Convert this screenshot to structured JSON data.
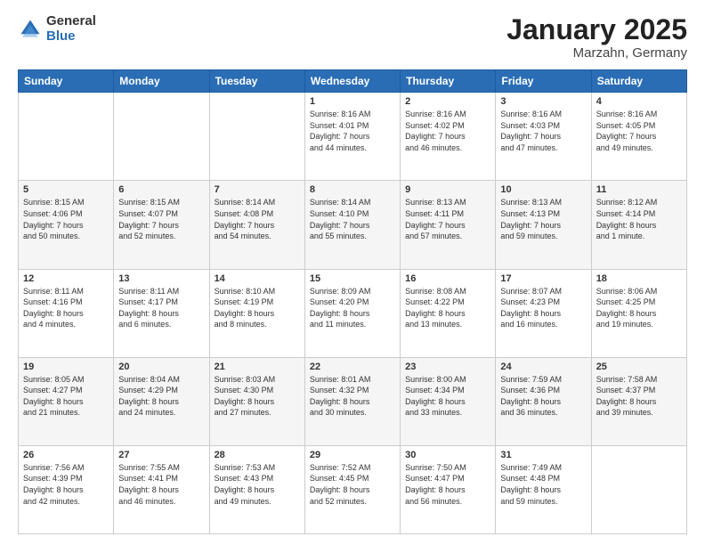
{
  "header": {
    "logo_general": "General",
    "logo_blue": "Blue",
    "title": "January 2025",
    "location": "Marzahn, Germany"
  },
  "days_of_week": [
    "Sunday",
    "Monday",
    "Tuesday",
    "Wednesday",
    "Thursday",
    "Friday",
    "Saturday"
  ],
  "weeks": [
    [
      {
        "day": "",
        "info": ""
      },
      {
        "day": "",
        "info": ""
      },
      {
        "day": "",
        "info": ""
      },
      {
        "day": "1",
        "info": "Sunrise: 8:16 AM\nSunset: 4:01 PM\nDaylight: 7 hours\nand 44 minutes."
      },
      {
        "day": "2",
        "info": "Sunrise: 8:16 AM\nSunset: 4:02 PM\nDaylight: 7 hours\nand 46 minutes."
      },
      {
        "day": "3",
        "info": "Sunrise: 8:16 AM\nSunset: 4:03 PM\nDaylight: 7 hours\nand 47 minutes."
      },
      {
        "day": "4",
        "info": "Sunrise: 8:16 AM\nSunset: 4:05 PM\nDaylight: 7 hours\nand 49 minutes."
      }
    ],
    [
      {
        "day": "5",
        "info": "Sunrise: 8:15 AM\nSunset: 4:06 PM\nDaylight: 7 hours\nand 50 minutes."
      },
      {
        "day": "6",
        "info": "Sunrise: 8:15 AM\nSunset: 4:07 PM\nDaylight: 7 hours\nand 52 minutes."
      },
      {
        "day": "7",
        "info": "Sunrise: 8:14 AM\nSunset: 4:08 PM\nDaylight: 7 hours\nand 54 minutes."
      },
      {
        "day": "8",
        "info": "Sunrise: 8:14 AM\nSunset: 4:10 PM\nDaylight: 7 hours\nand 55 minutes."
      },
      {
        "day": "9",
        "info": "Sunrise: 8:13 AM\nSunset: 4:11 PM\nDaylight: 7 hours\nand 57 minutes."
      },
      {
        "day": "10",
        "info": "Sunrise: 8:13 AM\nSunset: 4:13 PM\nDaylight: 7 hours\nand 59 minutes."
      },
      {
        "day": "11",
        "info": "Sunrise: 8:12 AM\nSunset: 4:14 PM\nDaylight: 8 hours\nand 1 minute."
      }
    ],
    [
      {
        "day": "12",
        "info": "Sunrise: 8:11 AM\nSunset: 4:16 PM\nDaylight: 8 hours\nand 4 minutes."
      },
      {
        "day": "13",
        "info": "Sunrise: 8:11 AM\nSunset: 4:17 PM\nDaylight: 8 hours\nand 6 minutes."
      },
      {
        "day": "14",
        "info": "Sunrise: 8:10 AM\nSunset: 4:19 PM\nDaylight: 8 hours\nand 8 minutes."
      },
      {
        "day": "15",
        "info": "Sunrise: 8:09 AM\nSunset: 4:20 PM\nDaylight: 8 hours\nand 11 minutes."
      },
      {
        "day": "16",
        "info": "Sunrise: 8:08 AM\nSunset: 4:22 PM\nDaylight: 8 hours\nand 13 minutes."
      },
      {
        "day": "17",
        "info": "Sunrise: 8:07 AM\nSunset: 4:23 PM\nDaylight: 8 hours\nand 16 minutes."
      },
      {
        "day": "18",
        "info": "Sunrise: 8:06 AM\nSunset: 4:25 PM\nDaylight: 8 hours\nand 19 minutes."
      }
    ],
    [
      {
        "day": "19",
        "info": "Sunrise: 8:05 AM\nSunset: 4:27 PM\nDaylight: 8 hours\nand 21 minutes."
      },
      {
        "day": "20",
        "info": "Sunrise: 8:04 AM\nSunset: 4:29 PM\nDaylight: 8 hours\nand 24 minutes."
      },
      {
        "day": "21",
        "info": "Sunrise: 8:03 AM\nSunset: 4:30 PM\nDaylight: 8 hours\nand 27 minutes."
      },
      {
        "day": "22",
        "info": "Sunrise: 8:01 AM\nSunset: 4:32 PM\nDaylight: 8 hours\nand 30 minutes."
      },
      {
        "day": "23",
        "info": "Sunrise: 8:00 AM\nSunset: 4:34 PM\nDaylight: 8 hours\nand 33 minutes."
      },
      {
        "day": "24",
        "info": "Sunrise: 7:59 AM\nSunset: 4:36 PM\nDaylight: 8 hours\nand 36 minutes."
      },
      {
        "day": "25",
        "info": "Sunrise: 7:58 AM\nSunset: 4:37 PM\nDaylight: 8 hours\nand 39 minutes."
      }
    ],
    [
      {
        "day": "26",
        "info": "Sunrise: 7:56 AM\nSunset: 4:39 PM\nDaylight: 8 hours\nand 42 minutes."
      },
      {
        "day": "27",
        "info": "Sunrise: 7:55 AM\nSunset: 4:41 PM\nDaylight: 8 hours\nand 46 minutes."
      },
      {
        "day": "28",
        "info": "Sunrise: 7:53 AM\nSunset: 4:43 PM\nDaylight: 8 hours\nand 49 minutes."
      },
      {
        "day": "29",
        "info": "Sunrise: 7:52 AM\nSunset: 4:45 PM\nDaylight: 8 hours\nand 52 minutes."
      },
      {
        "day": "30",
        "info": "Sunrise: 7:50 AM\nSunset: 4:47 PM\nDaylight: 8 hours\nand 56 minutes."
      },
      {
        "day": "31",
        "info": "Sunrise: 7:49 AM\nSunset: 4:48 PM\nDaylight: 8 hours\nand 59 minutes."
      },
      {
        "day": "",
        "info": ""
      }
    ]
  ]
}
